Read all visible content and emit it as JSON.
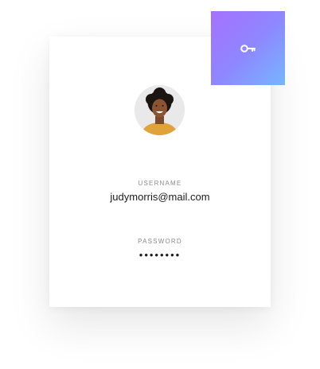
{
  "login": {
    "username_label": "USERNAME",
    "username_value": "judymorris@mail.com",
    "password_label": "PASSWORD",
    "password_value": "••••••••"
  },
  "icons": {
    "key_button": "key-icon",
    "avatar": "user-avatar"
  },
  "colors": {
    "gradient_start": "#a671ff",
    "gradient_end": "#76b5ff",
    "label": "#8a8a8a",
    "text": "#1b1b1b"
  }
}
